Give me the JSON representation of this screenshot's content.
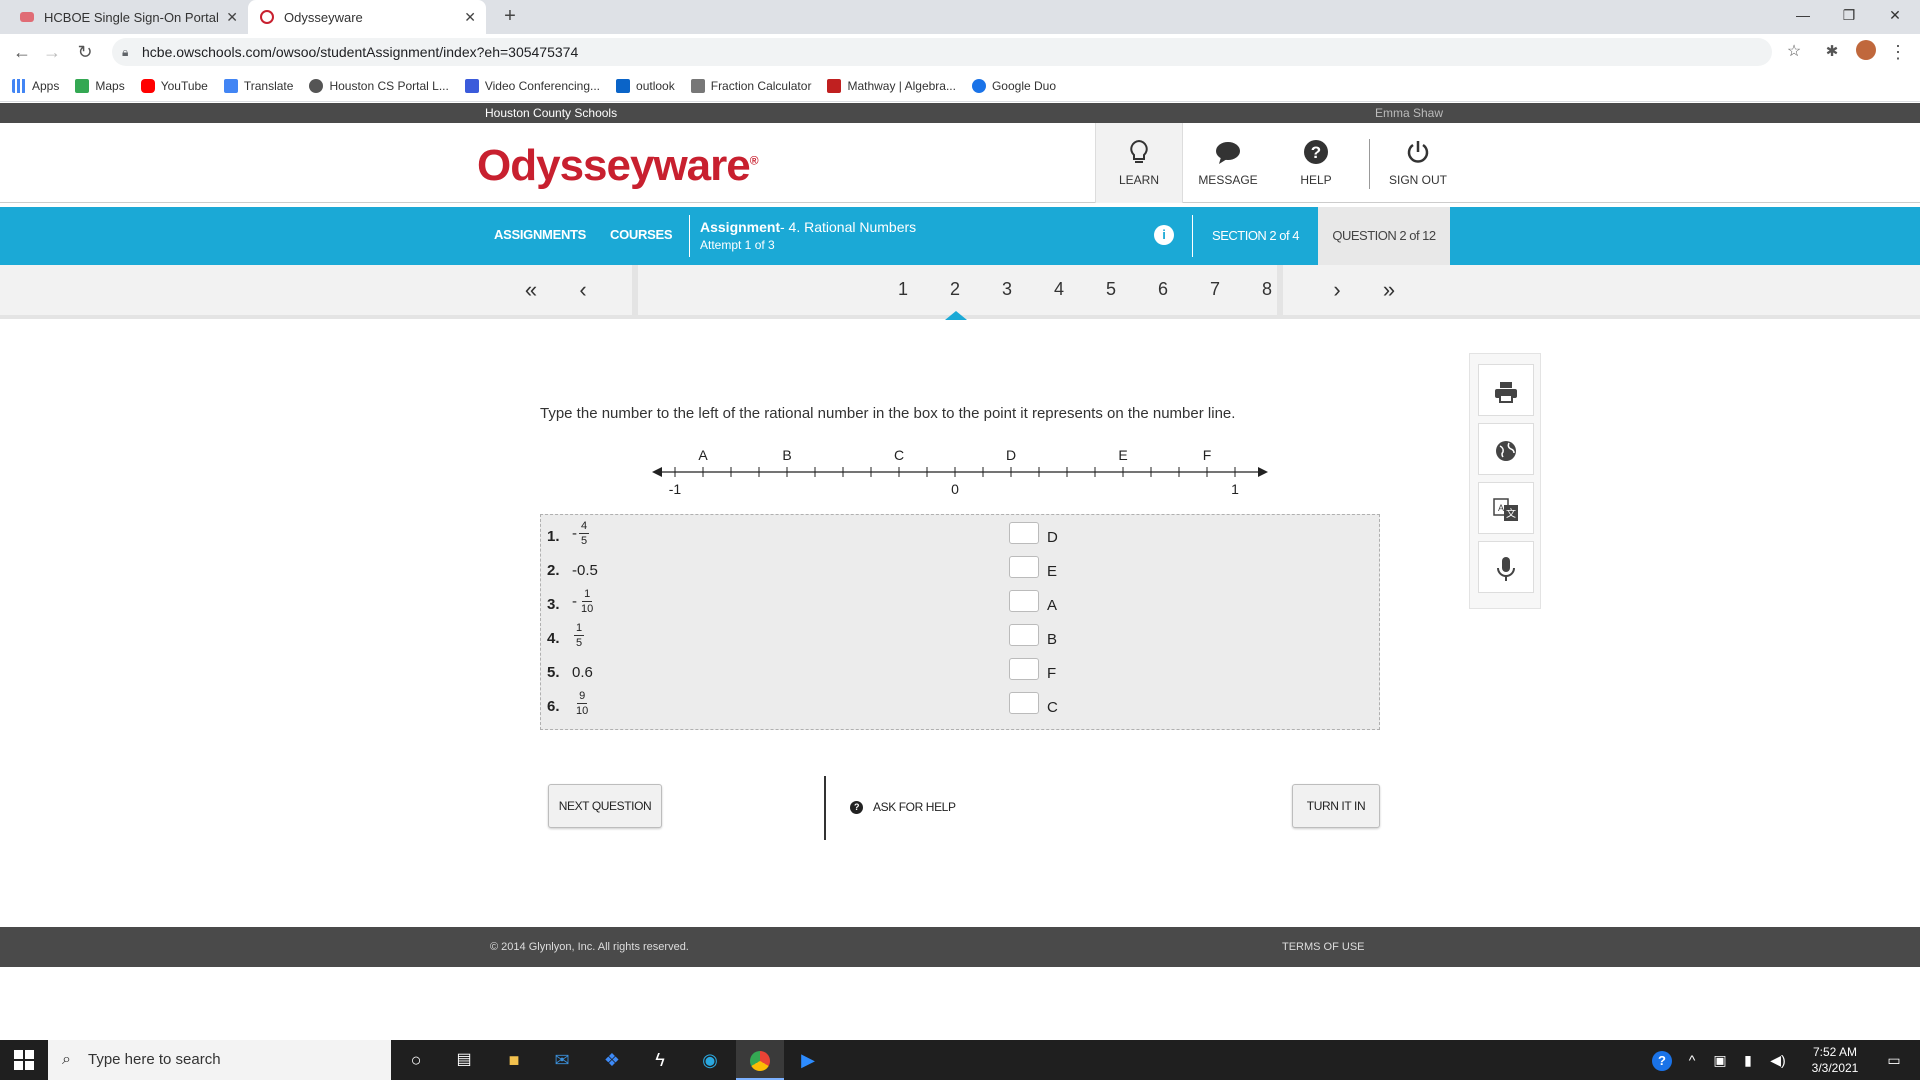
{
  "browser": {
    "tabs": [
      {
        "title": "HCBOE Single Sign-On Portal",
        "active": false
      },
      {
        "title": "Odysseyware",
        "active": true
      }
    ],
    "url": "hcbe.owschools.com/owsoo/studentAssignment/index?eh=305475374",
    "bookmarks": [
      "Apps",
      "Maps",
      "YouTube",
      "Translate",
      "Houston CS Portal L...",
      "Video Conferencing...",
      "outlook",
      "Fraction Calculator",
      "Mathway | Algebra...",
      "Google Duo"
    ]
  },
  "top_bar": {
    "district": "Houston County Schools",
    "user": "Emma Shaw"
  },
  "header": {
    "logo": "Odysseyware",
    "logo_mark": "®",
    "nav": {
      "learn": "LEARN",
      "message": "MESSAGE",
      "help": "HELP",
      "signout": "SIGN OUT"
    }
  },
  "assignment_bar": {
    "assignments": "ASSIGNMENTS",
    "courses": "COURSES",
    "assignment_label": "Assignment",
    "assignment_title": "- 4. Rational Numbers",
    "attempt": "Attempt 1 of 3",
    "info": "i",
    "section": "SECTION 2 of 4",
    "question": "QUESTION 2 of 12"
  },
  "pager": {
    "pages": [
      "1",
      "2",
      "3",
      "4",
      "5",
      "6",
      "7",
      "8"
    ],
    "current": "2"
  },
  "question": {
    "prompt": "Type the number to the left of the rational number in the box to the point it represents on the number line.",
    "number_line": {
      "min_label": "-1",
      "zero_label": "0",
      "max_label": "1",
      "points": [
        {
          "label": "A",
          "value": -0.9
        },
        {
          "label": "B",
          "value": -0.6
        },
        {
          "label": "C",
          "value": -0.2
        },
        {
          "label": "D",
          "value": 0.2
        },
        {
          "label": "E",
          "value": 0.6
        },
        {
          "label": "F",
          "value": 0.9
        }
      ]
    },
    "items": [
      {
        "num": "1.",
        "sign": "-",
        "numerator": "4",
        "denominator": "5",
        "box_value": "",
        "letter": "D"
      },
      {
        "num": "2.",
        "value": "-0.5",
        "box_value": "",
        "letter": "E"
      },
      {
        "num": "3.",
        "sign": "-",
        "numerator": "1",
        "denominator": "10",
        "box_value": "",
        "letter": "A"
      },
      {
        "num": "4.",
        "sign": "",
        "numerator": "1",
        "denominator": "5",
        "box_value": "",
        "letter": "B"
      },
      {
        "num": "5.",
        "value": "0.6",
        "box_value": "",
        "letter": "F"
      },
      {
        "num": "6.",
        "sign": "",
        "numerator": "9",
        "denominator": "10",
        "box_value": "",
        "letter": "C"
      }
    ]
  },
  "buttons": {
    "next": "NEXT QUESTION",
    "ask_help": "ASK FOR HELP",
    "turn_in": "TURN IT IN"
  },
  "footer": {
    "copyright": "© 2014 Glynlyon, Inc. All rights reserved.",
    "terms": "TERMS OF USE"
  },
  "taskbar": {
    "search_placeholder": "Type here to search",
    "time": "7:52 AM",
    "date": "3/3/2021"
  },
  "colors": {
    "brand_red": "#c8202f",
    "bar_blue": "#1ba9d6"
  }
}
